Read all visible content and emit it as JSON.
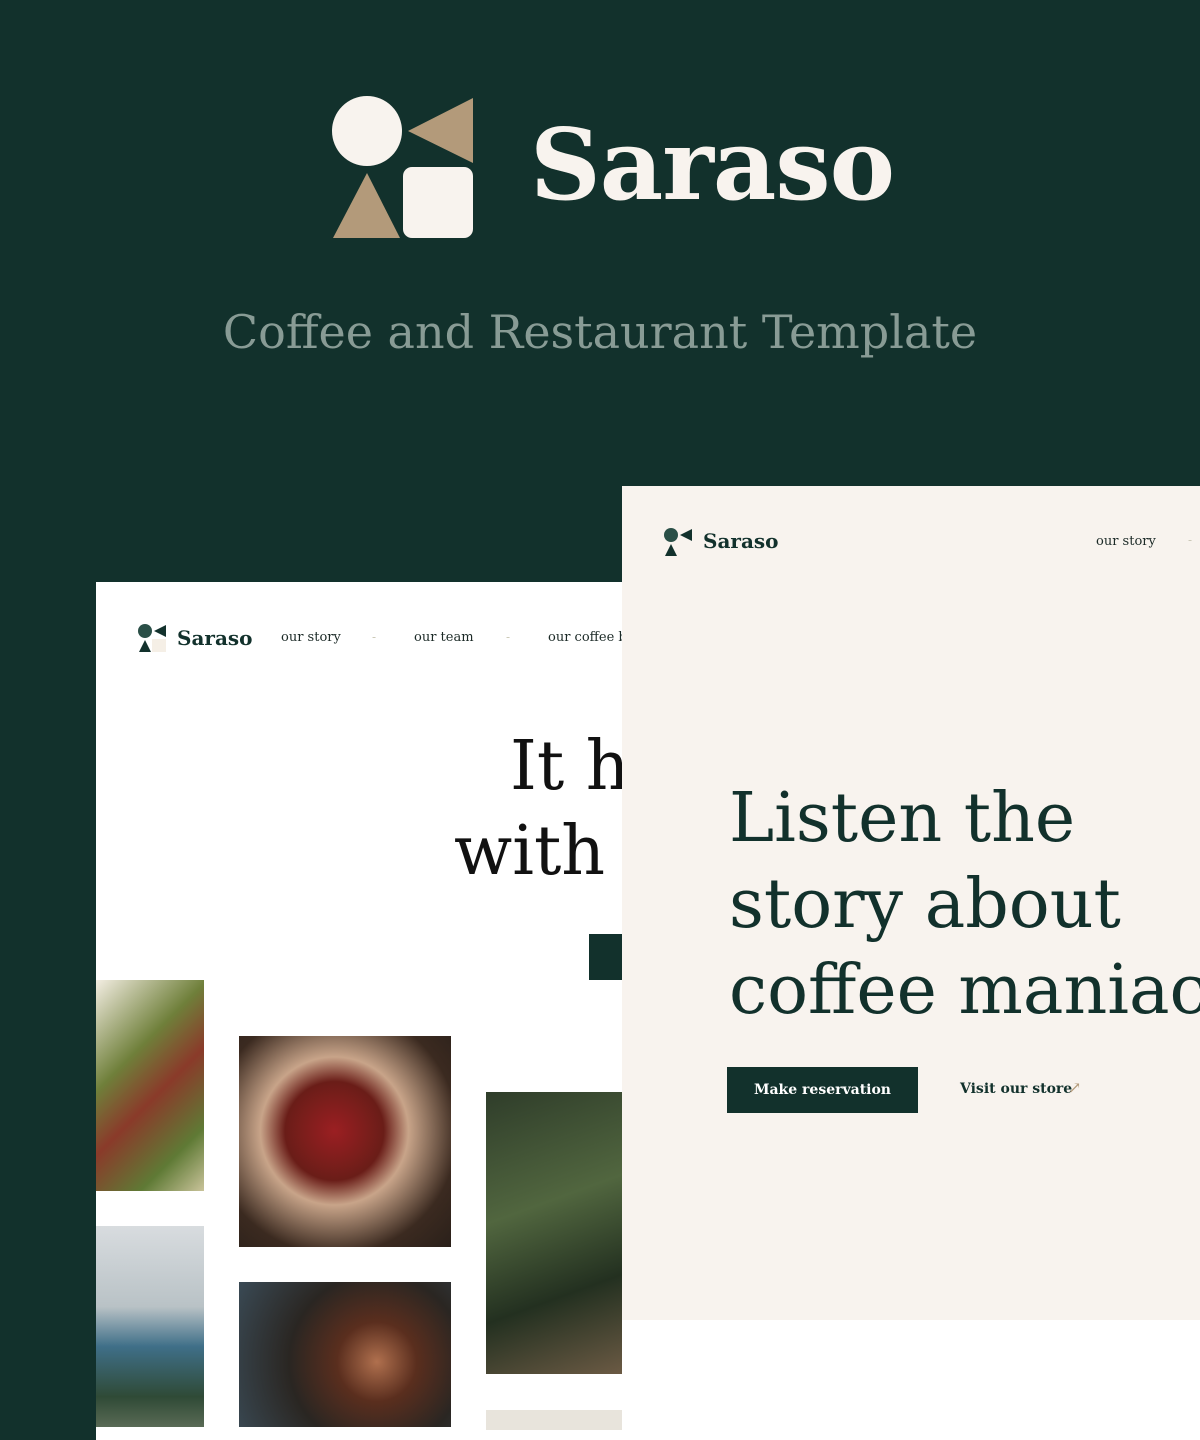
{
  "header": {
    "brand": "Saraso",
    "subtitle": "Coffee and Restaurant Template"
  },
  "colors": {
    "background": "#12312c",
    "accent": "#b39a7a",
    "cream": "#f8f3ee",
    "subtitle": "#889b95"
  },
  "left_preview": {
    "brand": "Saraso",
    "nav": [
      "our story",
      "our team",
      "our coffee b"
    ],
    "separator": "-",
    "hero_lines": [
      "It h",
      "with"
    ]
  },
  "right_preview": {
    "brand": "Saraso",
    "nav": [
      "our story"
    ],
    "separator": "-",
    "hero_lines": [
      "Listen the",
      "story about",
      "coffee maniacs"
    ],
    "primary_button": "Make reservation",
    "secondary_link": "Visit our store",
    "link_icon": "arrow-up-right-icon"
  }
}
